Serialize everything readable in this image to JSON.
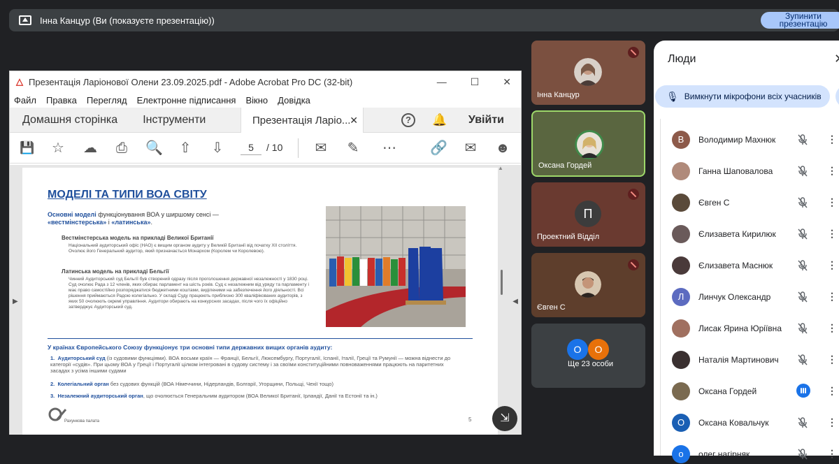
{
  "topbar": {
    "title": "Інна Канцур (Ви (показуєте презентацію))",
    "stop_button": "Зупинити презентацію"
  },
  "acrobat": {
    "window_title": "Презентація Ларіонової Олени 23.09.2025.pdf - Adobe Acrobat Pro DC (32-bit)",
    "menu": [
      "Файл",
      "Правка",
      "Перегляд",
      "Електронне підписання",
      "Вікно",
      "Довідка"
    ],
    "tabs": {
      "home": "Домашня сторінка",
      "tools": "Інструменти",
      "document": "Презентація Ларіо...",
      "login": "Увійти"
    },
    "page_current": "5",
    "page_total": "/ 10",
    "toolbar_icons": [
      "save-icon",
      "star-icon",
      "upload-icon",
      "print-icon",
      "zoom-icon",
      "page-up-icon",
      "page-down-icon",
      "comment-icon",
      "highlight-icon",
      "more-icon",
      "link-icon",
      "mail-icon",
      "add-user-icon"
    ]
  },
  "slide": {
    "title": "МОДЕЛІ ТА ТИПИ ВОА СВІТУ",
    "intro_1": "Основні моделі",
    "intro_2": " функціонування ВОА у ширшому сенсі —",
    "intro_3": "«вестмінстерська»",
    "intro_4": " і ",
    "intro_5": "«латинська»",
    "intro_6": ".",
    "h1": "Вестмінстерська модель на прикладі Великої Британії",
    "p1": "Національний аудиторський офіс (НАО) є вищим органом аудиту у Великій Британії від початку XII століття. Очолює його Генеральний аудитор, який призначається Монархом (Королем чи Королевою).",
    "h2": "Латинська модель на прикладі Бельгії",
    "p2": "Чинний Аудиторський суд Бельгії був створений одразу після проголошення державної незалежності у 1830 році. Суд очолює Рада з 12 членів, яких обирає парламент на шість років. Суд є незалежним від уряду та парламенту і має право самостійно розпоряджатися бюджетними коштами, виділеними на забезпечення його діяльності. Всі рішення приймаються Радою колегіально. У складі Суду працюють приблизно 300 кваліфікованих аудиторів, з яких 50 очолюють окремі управління. Аудитори обирають на конкурсних засадах, після чого їх офіційно затверджує Аудиторський суд.",
    "eu_heading": "У країнах Європейського Союзу функціонує три основні типи державних вищих органів аудиту:",
    "li1_bold": "Аудиторський суд",
    "li1_text": " (із судовими функціями). ВОА восьми країн — Франції, Бельгії, Люксембургу, Португалії, Іспанії, Італії, Греції та Румунії — можна віднести до категорії «судів». При цьому ВОА у Греції і Португалії цілком інтегровані в судову систему і за своїми конституційними повноваженнями працюють на паритетних засадах з усіма іншими судами",
    "li2_bold": "Колегіальний орган",
    "li2_text": " без судових функцій (ВОА Німеччини, Нідерландів, Болгарії, Угорщини, Польщі, Чехії тощо)",
    "li3_bold": "Незалежний аудиторський орган",
    "li3_text": ", що очолюється Генеральним аудитором (ВОА Великої Британії, Ірландії, Данії та Естонії та ін.)",
    "li_nums": [
      "1.",
      "2.",
      "3."
    ],
    "logo_text": "Рахункова палата",
    "page_number": "5"
  },
  "tiles": [
    {
      "name": "Інна Канцур"
    },
    {
      "name": "Оксана Гордей"
    },
    {
      "name": "Проектний Відділ",
      "initial": "П"
    },
    {
      "name": "Євген С"
    },
    {
      "name": "Ще 23 особи",
      "initials": [
        "О",
        "О"
      ]
    }
  ],
  "people_panel": {
    "title": "Люди",
    "mute_all": "Вимкнути мікрофони всіх учасників",
    "participants": [
      {
        "name": "Володимир Махнюк",
        "initial": "В",
        "color": "#8d5a4a"
      },
      {
        "name": "Ганна Шаповалова",
        "initial": "",
        "color": "#b08a7a"
      },
      {
        "name": "Євген С",
        "initial": "",
        "color": "#5a4a3a"
      },
      {
        "name": "Єлизавета Кирилюк",
        "initial": "",
        "color": "#6a5a5a"
      },
      {
        "name": "Єлизавета Маснюк",
        "initial": "",
        "color": "#4a3a3a"
      },
      {
        "name": "Линчук Олександр",
        "initial": "Л",
        "color": "#5c6bc0"
      },
      {
        "name": "Лисак Ярина Юріївна",
        "initial": "",
        "color": "#a07060"
      },
      {
        "name": "Наталія Мартинович",
        "initial": "",
        "color": "#3a3030"
      },
      {
        "name": "Оксана Гордей",
        "initial": "",
        "color": "#7a6a50"
      },
      {
        "name": "Оксана Ковальчук",
        "initial": "О",
        "color": "#1a5fb4"
      },
      {
        "name": "олег нагірняк",
        "initial": "о",
        "color": "#1a73e8"
      }
    ]
  }
}
